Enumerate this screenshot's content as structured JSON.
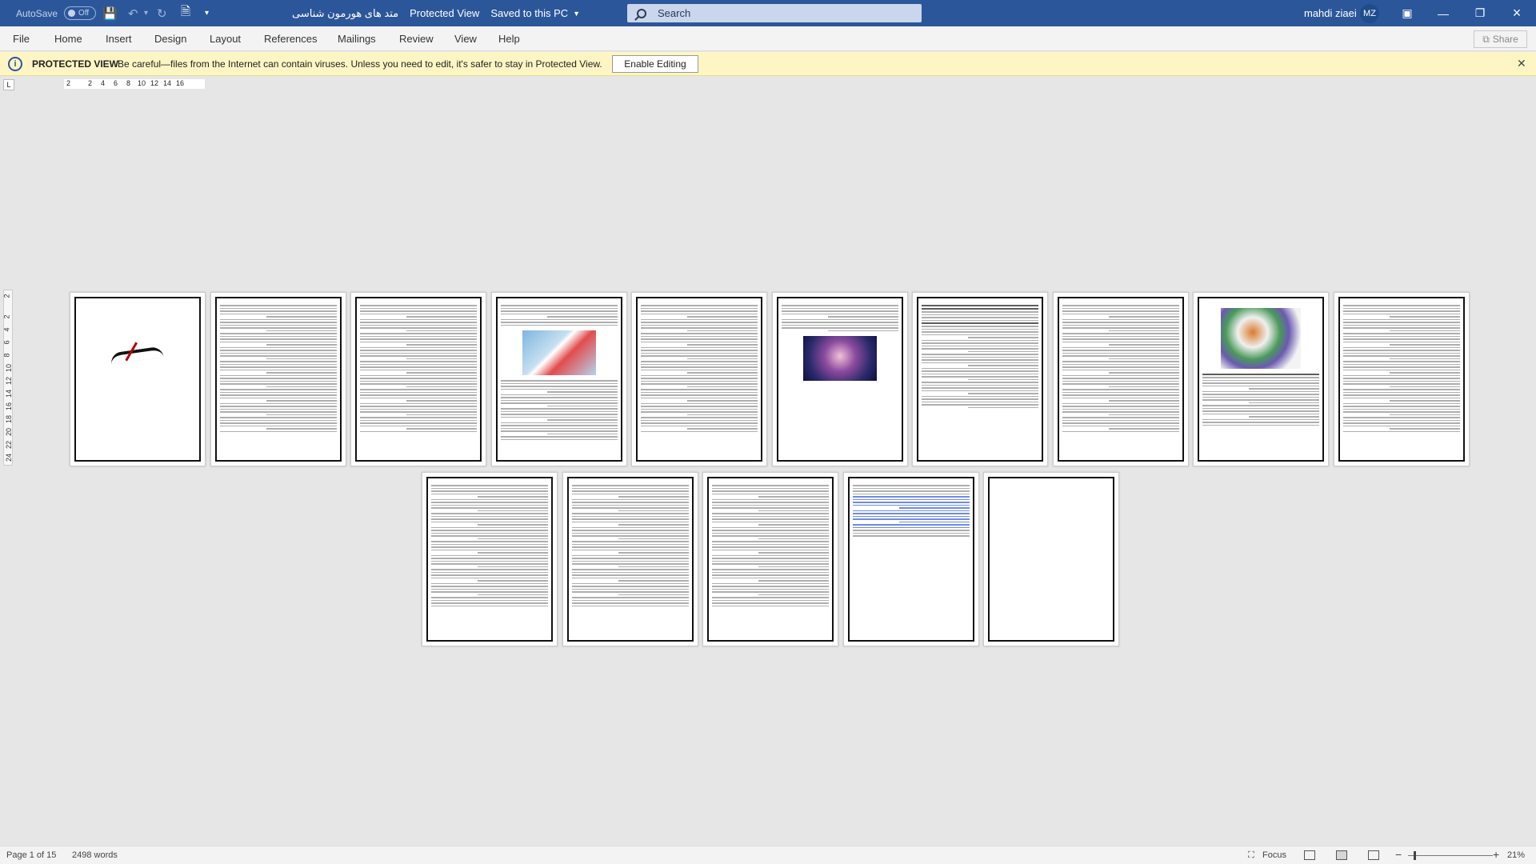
{
  "titlebar": {
    "autosave_label": "AutoSave",
    "autosave_state": "Off",
    "document_title": "متد های هورمون شناسی",
    "view_mode": "Protected View",
    "save_status": "Saved to this PC",
    "search_placeholder": "Search",
    "user_name": "mahdi ziaei",
    "user_initials": "MZ"
  },
  "ribbon": {
    "tabs": [
      "File",
      "Home",
      "Insert",
      "Design",
      "Layout",
      "References",
      "Mailings",
      "Review",
      "View",
      "Help"
    ],
    "share_label": "Share"
  },
  "protected_bar": {
    "title": "PROTECTED VIEW",
    "message": "Be careful—files from the Internet can contain viruses. Unless you need to edit, it's safer to stay in Protected View.",
    "enable_button": "Enable Editing"
  },
  "ruler": {
    "h_ticks": [
      "2",
      "2",
      "4",
      "6",
      "8",
      "10",
      "12",
      "14",
      "16"
    ],
    "v_ticks": [
      "2",
      "2",
      "4",
      "6",
      "8",
      "10",
      "12",
      "14",
      "16",
      "18",
      "20",
      "22",
      "24"
    ]
  },
  "pages": [
    {
      "kind": "calligraphy"
    },
    {
      "kind": "text"
    },
    {
      "kind": "text"
    },
    {
      "kind": "image-text",
      "image": "tube"
    },
    {
      "kind": "text"
    },
    {
      "kind": "image-text",
      "image": "brain"
    },
    {
      "kind": "text-headings"
    },
    {
      "kind": "text"
    },
    {
      "kind": "image-text",
      "image": "protein"
    },
    {
      "kind": "text"
    },
    {
      "kind": "text"
    },
    {
      "kind": "text"
    },
    {
      "kind": "text"
    },
    {
      "kind": "links"
    },
    {
      "kind": "blank"
    }
  ],
  "status": {
    "page_info": "Page 1 of 15",
    "word_count": "2498 words",
    "focus_label": "Focus",
    "zoom": "21%"
  }
}
